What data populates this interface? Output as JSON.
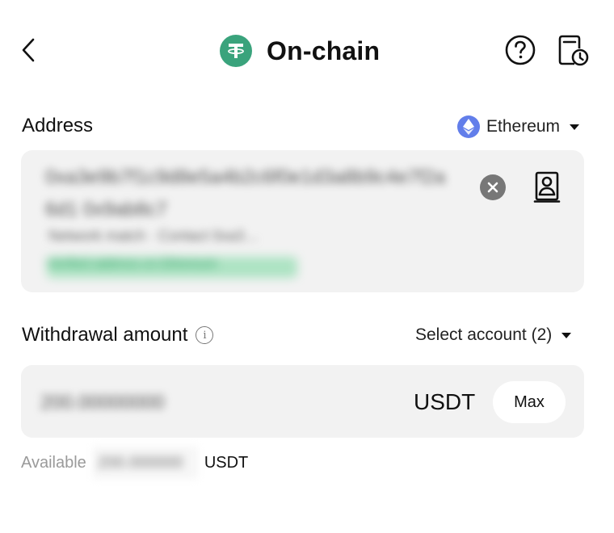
{
  "header": {
    "title": "On-chain",
    "back_icon": "chevron-left-icon",
    "coin_icon": "tether-logo-icon",
    "help_icon": "help-circle-icon",
    "history_icon": "history-clock-icon"
  },
  "address": {
    "label": "Address",
    "network": {
      "name": "Ethereum",
      "icon": "ethereum-icon",
      "icon_color": "#627eea"
    },
    "value": "0xa3e9b7f1c9d8e5a4b2c6f0e1d3a8b9c4e7f2a6d1 0x9ab8c7",
    "meta": "Network match · Contact 0xa3…",
    "status": "Verified address on Ethereum",
    "clear_icon": "clear-circle-icon",
    "contacts_icon": "address-book-icon"
  },
  "withdrawal": {
    "label": "Withdrawal amount",
    "info_icon": "info-icon",
    "account_select": "Select account (2)",
    "amount_value": "200.00000000",
    "currency": "USDT",
    "max_label": "Max",
    "available_label": "Available",
    "available_value": "200.000000",
    "available_currency": "USDT"
  },
  "colors": {
    "tether": "#3aa37c",
    "input_bg": "#f2f2f2"
  }
}
